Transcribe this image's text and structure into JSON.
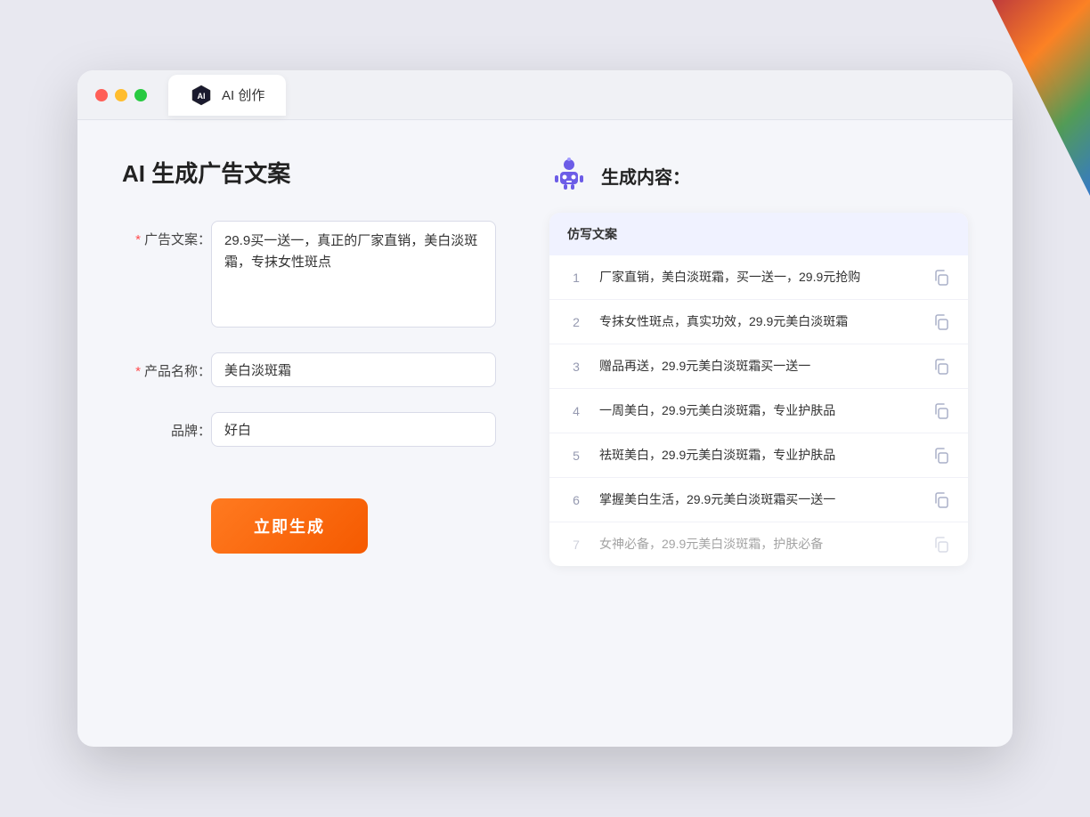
{
  "window": {
    "tab_title": "AI 创作"
  },
  "page": {
    "title": "AI 生成广告文案",
    "result_title": "生成内容："
  },
  "form": {
    "ad_copy_label": "广告文案：",
    "ad_copy_required": "*",
    "ad_copy_value": "29.9买一送一，真正的厂家直销，美白淡斑霜，专抹女性斑点",
    "product_label": "产品名称：",
    "product_required": "*",
    "product_value": "美白淡斑霜",
    "brand_label": "品牌：",
    "brand_value": "好白",
    "generate_button": "立即生成"
  },
  "table": {
    "header": "仿写文案",
    "rows": [
      {
        "num": "1",
        "text": "厂家直销，美白淡斑霜，买一送一，29.9元抢购",
        "faded": false
      },
      {
        "num": "2",
        "text": "专抹女性斑点，真实功效，29.9元美白淡斑霜",
        "faded": false
      },
      {
        "num": "3",
        "text": "赠品再送，29.9元美白淡斑霜买一送一",
        "faded": false
      },
      {
        "num": "4",
        "text": "一周美白，29.9元美白淡斑霜，专业护肤品",
        "faded": false
      },
      {
        "num": "5",
        "text": "祛斑美白，29.9元美白淡斑霜，专业护肤品",
        "faded": false
      },
      {
        "num": "6",
        "text": "掌握美白生活，29.9元美白淡斑霜买一送一",
        "faded": false
      },
      {
        "num": "7",
        "text": "女神必备，29.9元美白淡斑霜，护肤必备",
        "faded": true
      }
    ]
  },
  "colors": {
    "accent": "#f55a00",
    "required": "#ff4d4f",
    "tab_bg": "#f0f1f5"
  }
}
